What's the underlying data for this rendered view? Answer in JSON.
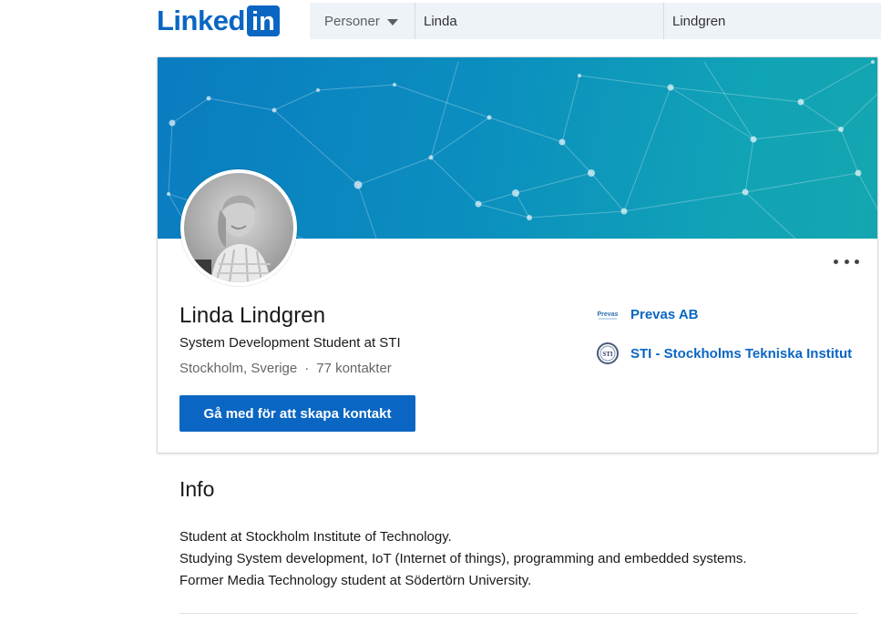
{
  "header": {
    "logo_text": "Linked",
    "logo_in": "in",
    "search_type": "Personer",
    "first_name_value": "Linda",
    "last_name_value": "Lindgren"
  },
  "profile": {
    "name": "Linda Lindgren",
    "headline": "System Development Student at STI",
    "location": "Stockholm, Sverige",
    "separator": "·",
    "connections": "77 kontakter",
    "connect_label": "Gå med för att skapa kontakt"
  },
  "organizations": [
    {
      "name": "Prevas AB",
      "logo_text": "Prevas",
      "icon": "prevas-logo-icon"
    },
    {
      "name": "STI - Stockholms Tekniska Institut",
      "logo_text": "STI",
      "icon": "sti-logo-icon"
    }
  ],
  "info": {
    "title": "Info",
    "lines": [
      "Student at Stockholm Institute of Technology.",
      "Studying System development, IoT (Internet of things), programming and embedded systems.",
      "Former Media Technology student at Södertörn University."
    ]
  },
  "colors": {
    "brand": "#0a66c2",
    "banner_start": "#0a7cc0",
    "banner_end": "#14a6b0"
  }
}
